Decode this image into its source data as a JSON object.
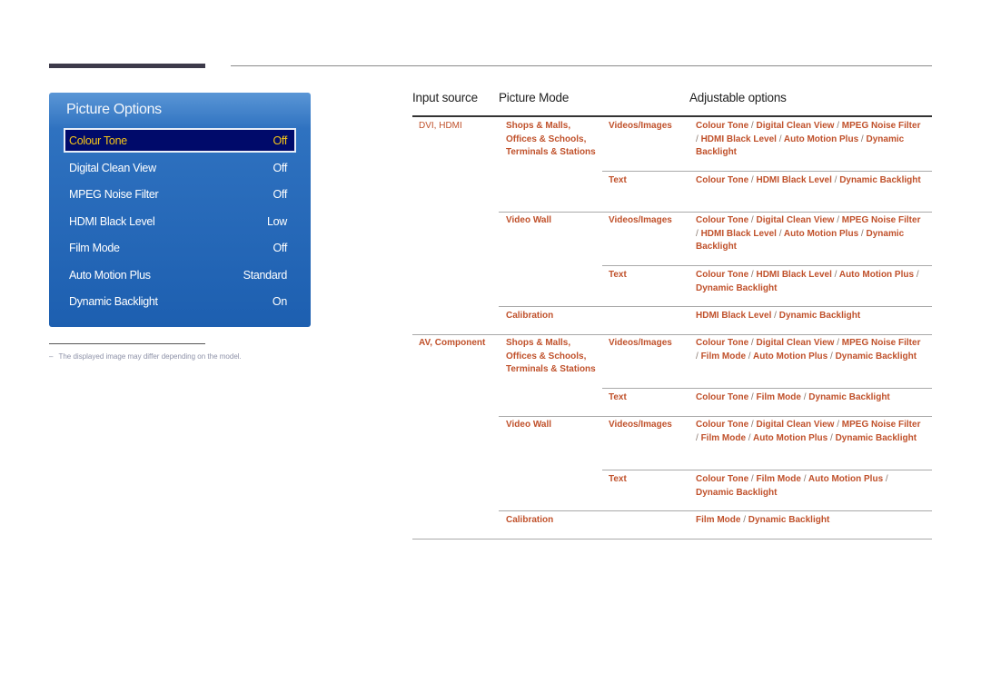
{
  "osd": {
    "title": "Picture Options",
    "items": [
      {
        "label": "Colour Tone",
        "value": "Off",
        "selected": true
      },
      {
        "label": "Digital Clean View",
        "value": "Off"
      },
      {
        "label": "MPEG Noise Filter",
        "value": "Off"
      },
      {
        "label": "HDMI Black Level",
        "value": "Low"
      },
      {
        "label": "Film Mode",
        "value": "Off"
      },
      {
        "label": "Auto Motion Plus",
        "value": "Standard"
      },
      {
        "label": "Dynamic Backlight",
        "value": "On"
      }
    ]
  },
  "footnote": {
    "dash": "–",
    "text": "The displayed image may differ depending on the model."
  },
  "table": {
    "headers": {
      "input_source": "Input source",
      "picture_mode": "Picture Mode",
      "adjustable": "Adjustable options"
    },
    "sources": [
      {
        "name": "DVI, HDMI"
      },
      {
        "name": "AV, Component"
      }
    ],
    "modes": [
      {
        "label": "Shops & Malls, Offices & Schools, Terminals & Stations"
      },
      {
        "label": "Video Wall"
      },
      {
        "label": "Calibration"
      },
      {
        "label": "Shops & Malls, Offices & Schools, Terminals & Stations"
      },
      {
        "label": "Video Wall"
      },
      {
        "label": "Calibration"
      }
    ],
    "rows": [
      {
        "sub": "Videos/Images",
        "options": [
          "Colour Tone",
          "Digital Clean View",
          "MPEG Noise Filter",
          "HDMI Black Level",
          "Auto Motion Plus",
          "Dynamic Backlight"
        ]
      },
      {
        "sub": "Text",
        "options": [
          "Colour Tone",
          "HDMI Black Level",
          "Dynamic Backlight"
        ]
      },
      {
        "sub": "Videos/Images",
        "options": [
          "Colour Tone",
          "Digital Clean View",
          "MPEG Noise Filter",
          "HDMI Black Level",
          "Auto Motion Plus",
          "Dynamic Backlight"
        ]
      },
      {
        "sub": "Text",
        "options": [
          "Colour Tone",
          "HDMI Black Level",
          "Auto Motion Plus",
          "Dynamic Backlight"
        ]
      },
      {
        "sub": "",
        "options": [
          "HDMI Black Level",
          "Dynamic Backlight"
        ]
      },
      {
        "sub": "Videos/Images",
        "options": [
          "Colour Tone",
          "Digital Clean View",
          "MPEG Noise Filter",
          "Film Mode",
          "Auto Motion Plus",
          "Dynamic Backlight"
        ]
      },
      {
        "sub": "Text",
        "options": [
          "Colour Tone",
          "Film Mode",
          "Dynamic Backlight"
        ]
      },
      {
        "sub": "Videos/Images",
        "options": [
          "Colour Tone",
          "Digital Clean View",
          "MPEG Noise Filter",
          "Film Mode",
          "Auto Motion Plus",
          "Dynamic Backlight"
        ]
      },
      {
        "sub": "Text",
        "options": [
          "Colour Tone",
          "Film Mode",
          "Auto Motion Plus",
          "Dynamic Backlight"
        ]
      },
      {
        "sub": "",
        "options": [
          "Film Mode",
          "Dynamic Backlight"
        ]
      }
    ],
    "separator": "/"
  },
  "colors": {
    "accent_text": "#c0512b",
    "osd_blue": "#1d5fb0",
    "osd_selected_bg": "#000a6a",
    "osd_selected_text": "#f5c518"
  }
}
